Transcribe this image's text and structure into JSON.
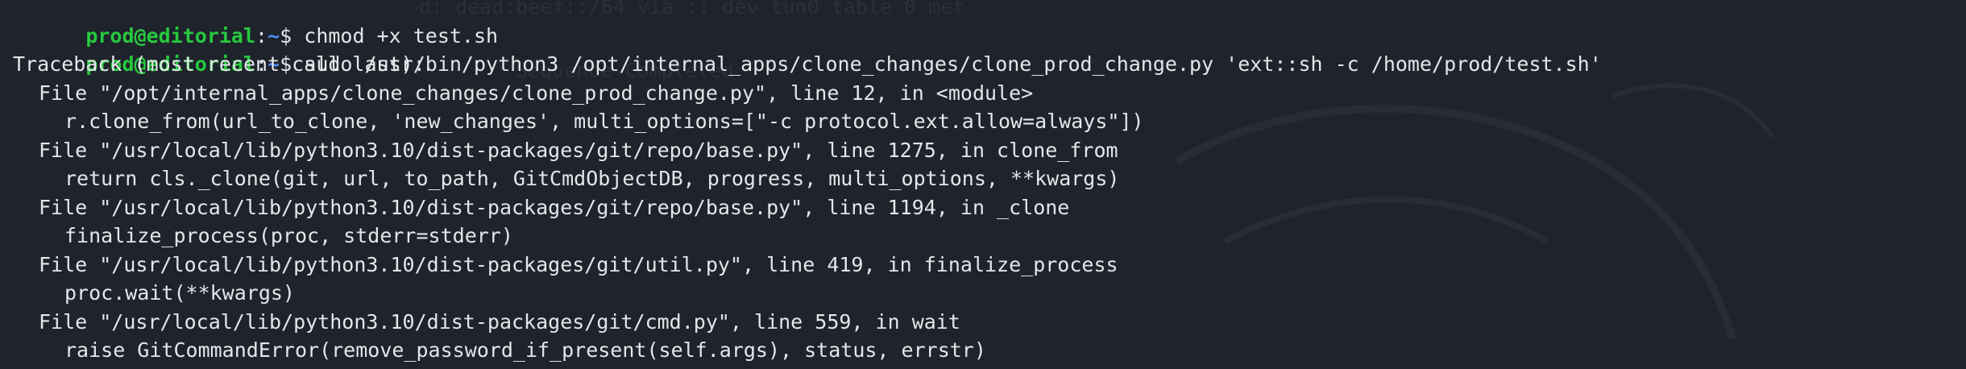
{
  "prompt": {
    "user_host": "prod@editorial",
    "cwd": "~",
    "symbol": "$"
  },
  "lines": [
    {
      "type": "prompt",
      "command": " chmod +x test.sh"
    },
    {
      "type": "prompt",
      "command": " sudo /usr/bin/python3 /opt/internal_apps/clone_changes/clone_prod_change.py 'ext::sh -c /home/prod/test.sh'"
    },
    {
      "type": "output",
      "indent": 0,
      "text": "Traceback (most recent call last):"
    },
    {
      "type": "output",
      "indent": 1,
      "text": "File \"/opt/internal_apps/clone_changes/clone_prod_change.py\", line 12, in <module>"
    },
    {
      "type": "output",
      "indent": 2,
      "text": "r.clone_from(url_to_clone, 'new_changes', multi_options=[\"-c protocol.ext.allow=always\"])"
    },
    {
      "type": "output",
      "indent": 1,
      "text": "File \"/usr/local/lib/python3.10/dist-packages/git/repo/base.py\", line 1275, in clone_from"
    },
    {
      "type": "output",
      "indent": 2,
      "text": "return cls._clone(git, url, to_path, GitCmdObjectDB, progress, multi_options, **kwargs)"
    },
    {
      "type": "output",
      "indent": 1,
      "text": "File \"/usr/local/lib/python3.10/dist-packages/git/repo/base.py\", line 1194, in _clone"
    },
    {
      "type": "output",
      "indent": 2,
      "text": "finalize_process(proc, stderr=stderr)"
    },
    {
      "type": "output",
      "indent": 1,
      "text": "File \"/usr/local/lib/python3.10/dist-packages/git/util.py\", line 419, in finalize_process"
    },
    {
      "type": "output",
      "indent": 2,
      "text": "proc.wait(**kwargs)"
    },
    {
      "type": "output",
      "indent": 1,
      "text": "File \"/usr/local/lib/python3.10/dist-packages/git/cmd.py\", line 559, in wait"
    },
    {
      "type": "output",
      "indent": 2,
      "text": "raise GitCommandError(remove_password_if_present(self.args), status, errstr)"
    }
  ],
  "background_text": [
    "d: dead:beef::/64 via :: dev tun0 table 0 met",
    "Sequence Completed"
  ],
  "colors": {
    "background": "#1f232b",
    "user_host": "#27c93f",
    "path": "#4b8cf5",
    "text": "#e4e6ea"
  }
}
